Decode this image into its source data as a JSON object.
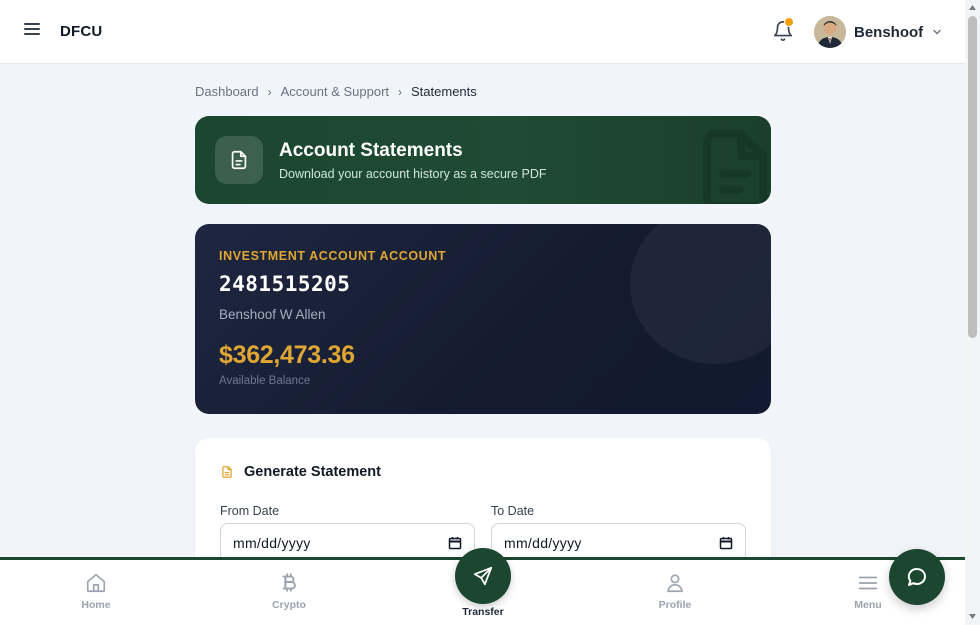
{
  "header": {
    "brand": "DFCU",
    "user_name": "Benshoof",
    "menu_icon": "hamburger-icon",
    "bell_icon": "bell-icon",
    "notification_dot_color": "#f59e0b"
  },
  "breadcrumb": {
    "items": [
      "Dashboard",
      "Account & Support",
      "Statements"
    ]
  },
  "hero": {
    "title": "Account Statements",
    "subtitle": "Download your account history as a secure PDF",
    "icon": "document-icon",
    "bg_color": "#1b4630"
  },
  "account": {
    "type": "INVESTMENT ACCOUNT ACCOUNT",
    "number": "2481515205",
    "holder": "Benshoof W Allen",
    "balance": "$362,473.36",
    "balance_label": "Available Balance",
    "accent_color": "#e0a633"
  },
  "generate": {
    "title": "Generate Statement",
    "from_label": "From Date",
    "from_value": "mm/dd/yyyy",
    "to_label": "To Date",
    "to_value": "mm/dd/yyyy"
  },
  "bottom_nav": {
    "items": [
      {
        "label": "Home",
        "icon": "home-icon"
      },
      {
        "label": "Crypto",
        "icon": "bitcoin-icon"
      },
      {
        "label": "Transfer",
        "icon": "send-icon"
      },
      {
        "label": "Profile",
        "icon": "user-icon"
      },
      {
        "label": "Menu",
        "icon": "menu-icon"
      }
    ]
  },
  "chat": {
    "icon": "chat-bubble-icon"
  }
}
